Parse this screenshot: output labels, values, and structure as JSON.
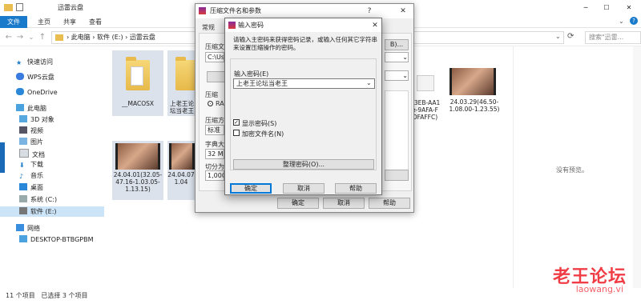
{
  "explorer": {
    "title": "迅雷云盘",
    "ribbon_tabs": {
      "file": "文件",
      "home": "主页",
      "share": "共享",
      "view": "查看"
    },
    "breadcrumb": [
      "此电脑",
      "软件 (E:)",
      "迅雷云盘"
    ],
    "search_placeholder": "搜索\"迅雷...",
    "sidebar": {
      "quick_access": "快速访问",
      "wps": "WPS云盘",
      "onedrive": "OneDrive",
      "this_pc": "此电脑",
      "objects3d": "3D 对象",
      "videos": "视频",
      "pictures": "图片",
      "documents": "文档",
      "downloads": "下载",
      "music": "音乐",
      "desktop": "桌面",
      "system_c": "系统 (C:)",
      "software_e": "软件 (E:)",
      "network": "网络",
      "desktop_pc": "DESKTOP-BTBGPBM"
    },
    "files": {
      "macosx": "__MACOSX",
      "folder2": "上老王论坛当老王",
      "partial_label": "C3EB-AA1 e-9AFA-F DFAFFC)",
      "video_right": "24.03.29(46.50-1.08.00-1.23.55)",
      "video_a": "24.04.01(32.05-47.16-1.03.05-1.13.15)",
      "video_b_partial": "24.04.07 1.04"
    },
    "preview_text": "没有预览。",
    "status": {
      "count": "11 个项目",
      "selected": "已选择 3 个项目"
    }
  },
  "back_dialog": {
    "title": "压缩文件名和参数",
    "tab_general": "常规",
    "label_archive": "压缩文",
    "path_value": "C:\\Use",
    "label_update": "压缩",
    "radio_rar": "RA",
    "label_method": "压缩方",
    "method_value": "标准",
    "label_dict": "字典大",
    "dict_value": "32 MB",
    "label_split": "切分为",
    "split_value": "1,000",
    "btn_browse": "B)...",
    "help_char": "?",
    "ok": "确定",
    "cancel": "取消",
    "help": "帮助"
  },
  "password_dialog": {
    "title": "输入密码",
    "instruction": "请输入主密码来获得密码记录，或输入任何其它字符串来设置压缩操作的密码。",
    "field_label": "输入密码(E)",
    "field_value": "上老王论坛当老王",
    "show_password": "显示密码(S)",
    "show_password_checked": true,
    "encrypt_filenames": "加密文件名(N)",
    "encrypt_filenames_checked": false,
    "organize_button": "整理密码(O)...",
    "ok": "确定",
    "cancel": "取消",
    "help": "帮助"
  },
  "watermark": {
    "main": "老王论坛",
    "sub": "laowang.vi"
  }
}
